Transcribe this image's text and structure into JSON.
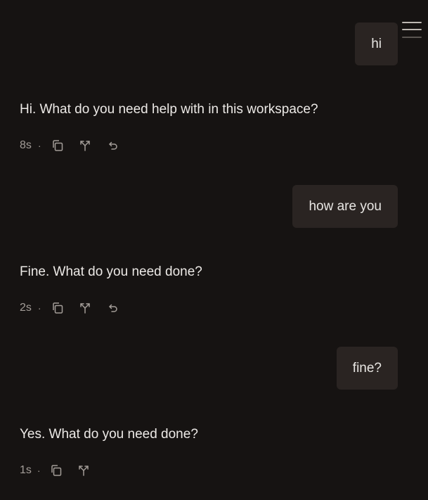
{
  "messages": [
    {
      "role": "user",
      "text": "hi"
    },
    {
      "role": "assistant",
      "text": "Hi. What do you need help with in this workspace?",
      "duration": "8s",
      "separator": "·",
      "icons": [
        "copy-icon",
        "branch-icon",
        "retry-icon"
      ]
    },
    {
      "role": "user",
      "text": "how are you"
    },
    {
      "role": "assistant",
      "text": "Fine. What do you need done?",
      "duration": "2s",
      "separator": "·",
      "icons": [
        "copy-icon",
        "branch-icon",
        "retry-icon"
      ]
    },
    {
      "role": "user",
      "text": "fine?"
    },
    {
      "role": "assistant",
      "text": "Yes. What do you need done?",
      "duration": "1s",
      "separator": "·",
      "icons": [
        "copy-icon",
        "branch-icon"
      ]
    }
  ],
  "menu": {
    "icon": "hamburger-menu-icon"
  }
}
